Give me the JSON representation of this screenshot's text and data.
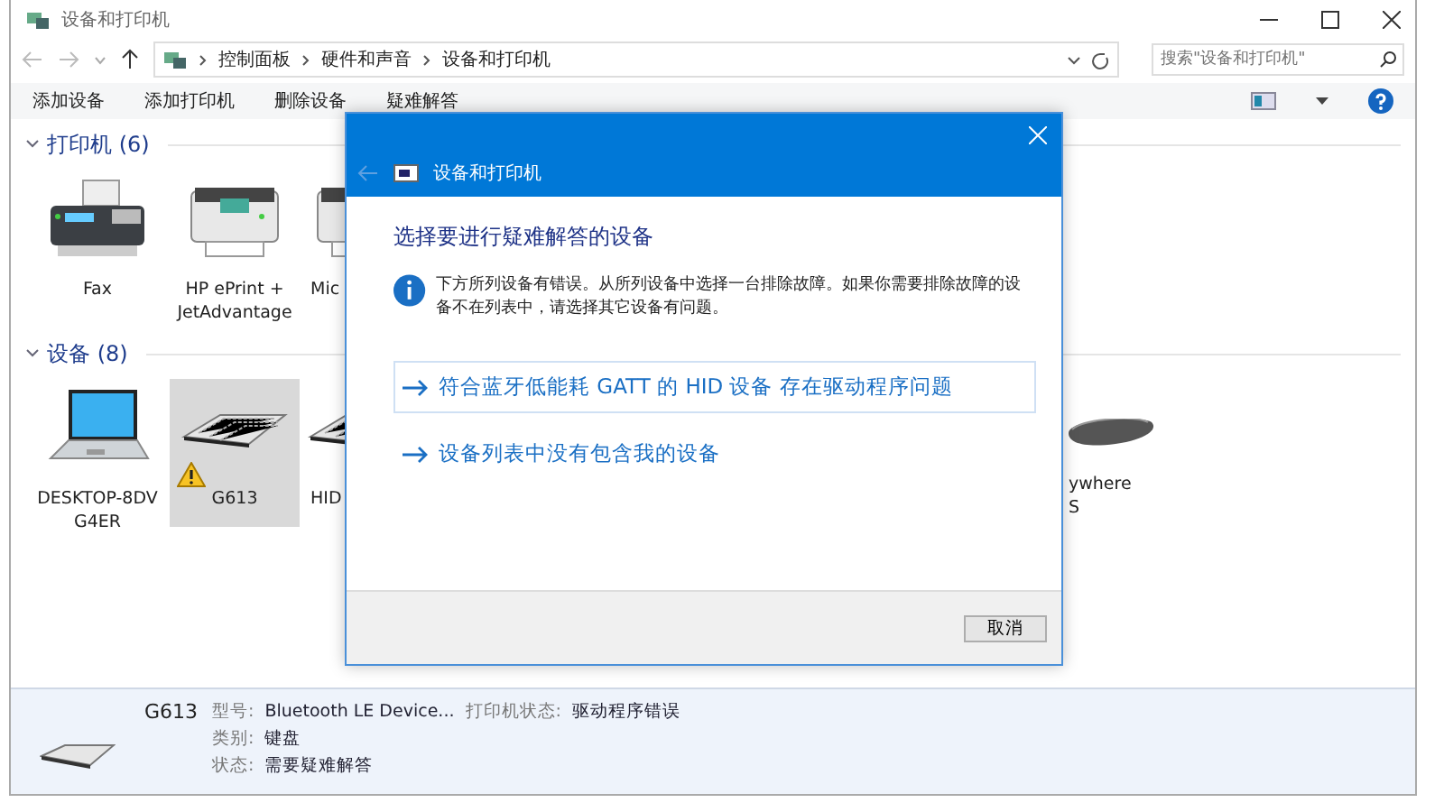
{
  "window": {
    "title": "设备和打印机"
  },
  "address": {
    "breadcrumb": [
      "控制面板",
      "硬件和声音",
      "设备和打印机"
    ]
  },
  "search": {
    "placeholder": "搜索\"设备和打印机\""
  },
  "commands": [
    "添加设备",
    "添加打印机",
    "删除设备",
    "疑难解答"
  ],
  "groups": [
    {
      "title": "打印机 (6)",
      "expanded": true,
      "items": [
        {
          "kind": "fax",
          "name": [
            "Fax"
          ],
          "selected": false,
          "warning": false
        },
        {
          "kind": "printer",
          "name": [
            "HP ePrint +",
            "JetAdvantage"
          ],
          "selected": false,
          "warning": false
        },
        {
          "kind": "printer",
          "name": [
            "Mic"
          ],
          "selected": false,
          "warning": false
        }
      ]
    },
    {
      "title": "设备 (8)",
      "expanded": true,
      "items": [
        {
          "kind": "laptop",
          "name": [
            "DESKTOP-8DV",
            "G4ER"
          ],
          "selected": false,
          "warning": false
        },
        {
          "kind": "keyboard",
          "name": [
            "G613"
          ],
          "selected": true,
          "warning": true
        },
        {
          "kind": "keyboard",
          "name": [
            "HID"
          ],
          "selected": false,
          "warning": false
        },
        {
          "kind": "mouse",
          "name": [
            "ywhere",
            "S"
          ],
          "selected": false,
          "warning": false
        }
      ]
    }
  ],
  "details": {
    "name": "G613",
    "fields": [
      {
        "label": "型号:",
        "value": "Bluetooth LE Device..."
      },
      {
        "label": "打印机状态:",
        "value": "驱动程序错误"
      },
      {
        "label": "类别:",
        "value": "键盘"
      },
      {
        "label": "状态:",
        "value": "需要疑难解答"
      }
    ]
  },
  "dialog": {
    "title": "设备和打印机",
    "heading": "选择要进行疑难解答的设备",
    "info": "下方所列设备有错误。从所列设备中选择一台排除故障。如果你需要排除故障的设备不在列表中，请选择其它设备有问题。",
    "options": [
      {
        "text": "符合蓝牙低能耗 GATT 的 HID 设备 存在驱动程序问题",
        "selected": true
      },
      {
        "text": "设备列表中没有包含我的设备",
        "selected": false
      }
    ],
    "button": "取消"
  }
}
